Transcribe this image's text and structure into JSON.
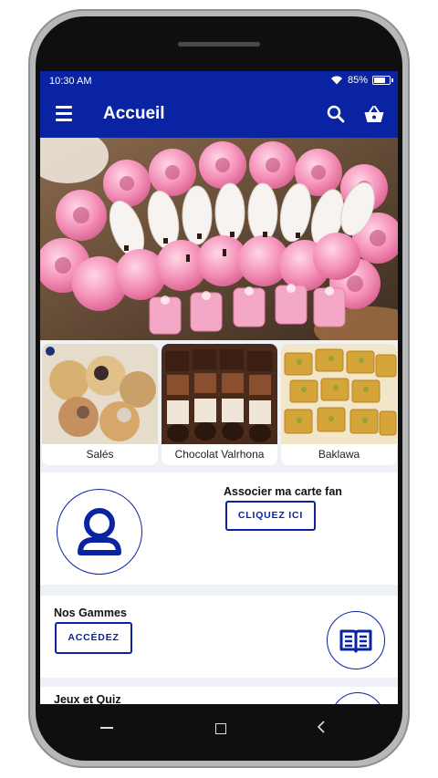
{
  "status_bar": {
    "time": "10:30 AM",
    "battery": "85%"
  },
  "app_bar": {
    "title": "Accueil",
    "icons": [
      "menu-icon",
      "search-icon",
      "basket-icon"
    ]
  },
  "categories": [
    {
      "label": "Salés"
    },
    {
      "label": "Chocolat Valrhona"
    },
    {
      "label": "Baklawa"
    }
  ],
  "fan_card": {
    "title": "Associer ma carte fan",
    "button_label": "CLIQUEZ ICI",
    "icon": "user-icon"
  },
  "gammes": {
    "title": "Nos Gammes",
    "button_label": "ACCÉDEZ",
    "icon": "book-icon"
  },
  "jeux": {
    "title": "Jeux et Quiz"
  },
  "colors": {
    "primary": "#0a23a3",
    "background": "#eef1f6"
  }
}
